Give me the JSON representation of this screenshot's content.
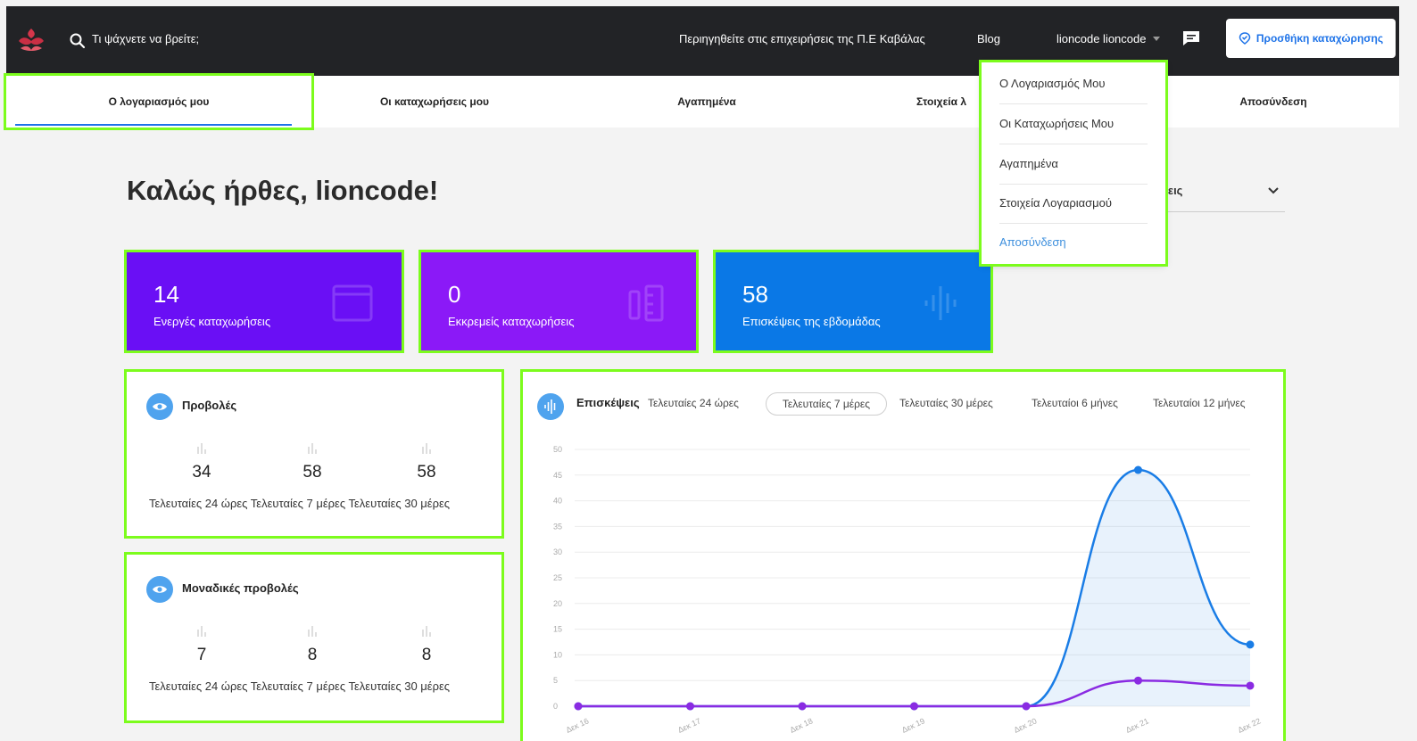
{
  "header": {
    "search_placeholder": "Τι ψάχνετε να βρείτε;",
    "browse_link": "Περιηγηθείτε στις επιχειρήσεις της Π.Ε Καβάλας",
    "blog_link": "Blog",
    "user_name": "lioncode lioncode",
    "add_listing": "Προσθήκη καταχώρησης"
  },
  "tabs": [
    {
      "label": "Ο λογαριασμός μου"
    },
    {
      "label": "Οι καταχωρήσεις μου"
    },
    {
      "label": "Αγαπημένα"
    },
    {
      "label": "Στοιχεία λ"
    },
    {
      "label": "Αποσύνδεση"
    }
  ],
  "dropdown": {
    "items": [
      "Ο Λογαριασμός Μου",
      "Οι Καταχωρήσεις Μου",
      "Αγαπημένα",
      "Στοιχεία Λογαριασμού",
      "Αποσύνδεση"
    ]
  },
  "welcome": "Καλώς ήρθες, lioncode!",
  "select_partial": "σεις",
  "stats": [
    {
      "value": "14",
      "label": "Ενεργές καταχωρήσεις",
      "color": "#6a0ff5"
    },
    {
      "value": "0",
      "label": "Εκκρεμείς καταχωρήσεις",
      "color": "#8b19f7"
    },
    {
      "value": "58",
      "label": "Επισκέψεις της εβδομάδας",
      "color": "#0a78e6"
    }
  ],
  "views": {
    "title": "Προβολές",
    "values": [
      "34",
      "58",
      "58"
    ],
    "labels": "Τελευταίες 24 ώρες Τελευταίες 7 μέρες Τελευταίες 30 μέρες"
  },
  "unique_views": {
    "title": "Μοναδικές προβολές",
    "values": [
      "7",
      "8",
      "8"
    ],
    "labels": "Τελευταίες 24 ώρες Τελευταίες 7 μέρες Τελευταίες 30 μέρες"
  },
  "visits": {
    "title": "Επισκέψεις",
    "ranges": [
      "Τελευταίες 24 ώρες",
      "Τελευταίες 7 μέρες",
      "Τελευταίες 30 μέρες",
      "Τελευταίοι 6 μήνες",
      "Τελευταίοι 12 μήνες"
    ],
    "selected": "Τελευταίες 7 μέρες"
  },
  "chart_data": {
    "type": "line",
    "x": [
      "Δεκ 16",
      "Δεκ 17",
      "Δεκ 18",
      "Δεκ 19",
      "Δεκ 20",
      "Δεκ 21",
      "Δεκ 22"
    ],
    "ylim": [
      0,
      50
    ],
    "yticks": [
      0,
      5,
      10,
      15,
      20,
      25,
      30,
      35,
      40,
      45,
      50
    ],
    "grid": true,
    "series": [
      {
        "values": [
          0,
          0,
          0,
          0,
          0,
          46,
          12
        ],
        "color": "#1a7de6",
        "fill": true
      },
      {
        "values": [
          0,
          0,
          0,
          0,
          0,
          5,
          4
        ],
        "color": "#8a2be2",
        "fill": false
      }
    ]
  }
}
